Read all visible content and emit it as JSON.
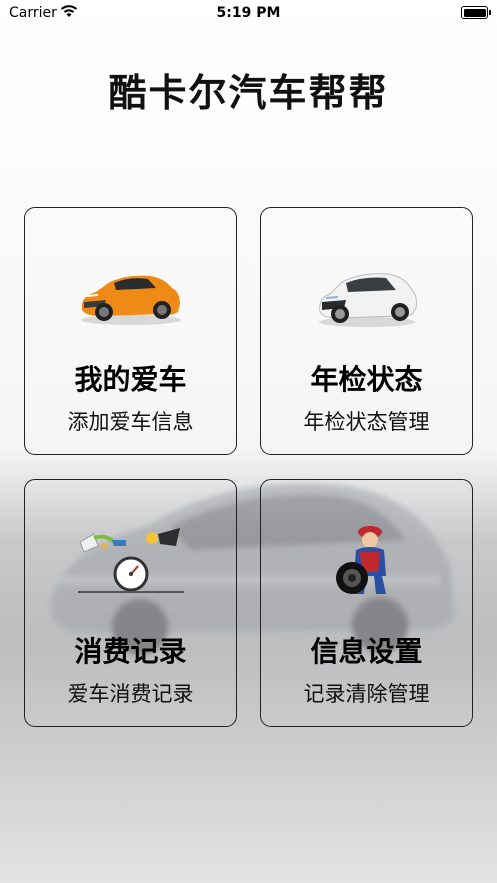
{
  "status_bar": {
    "carrier": "Carrier",
    "time": "5:19 PM",
    "wifi_icon": "wifi-icon",
    "battery_icon": "battery-icon"
  },
  "app": {
    "title": "酷卡尔汽车帮帮"
  },
  "menu": [
    {
      "title": "我的爱车",
      "subtitle": "添加爱车信息",
      "icon": "orange-sports-car-icon",
      "accent": "#f08a16"
    },
    {
      "title": "年检状态",
      "subtitle": "年检状态管理",
      "icon": "white-sedan-icon",
      "accent": "#e8e8e8"
    },
    {
      "title": "消费记录",
      "subtitle": "爱车消费记录",
      "icon": "fuel-payment-icon",
      "accent": "#7cc043"
    },
    {
      "title": "信息设置",
      "subtitle": "记录清除管理",
      "icon": "mechanic-tire-icon",
      "accent": "#c0282d"
    }
  ]
}
